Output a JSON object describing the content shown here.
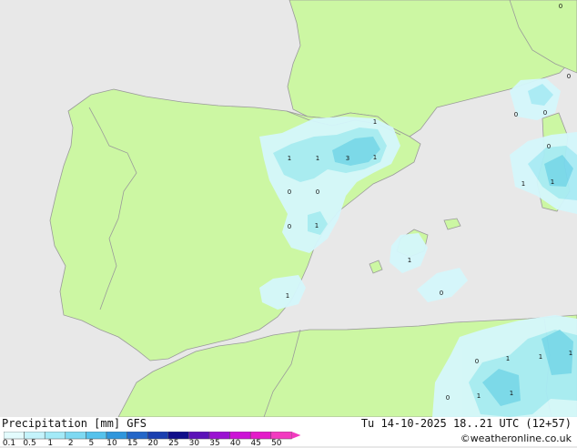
{
  "map": {
    "colors": {
      "sea": "#e8e8e8",
      "land": "#ccf7a3",
      "border": "#9a9a9a",
      "precip_light": "#d5f7fc",
      "precip_mid": "#a8ecf5",
      "precip_heavy": "#78d8ec"
    },
    "point_labels": [
      "1",
      "1",
      "1",
      "3",
      "1",
      "1",
      "0",
      "0",
      "0",
      "1",
      "1",
      "1",
      "0",
      "0",
      "0",
      "0",
      "1",
      "0",
      "0",
      "0",
      "1",
      "1",
      "1",
      "0",
      "1",
      "1"
    ]
  },
  "footer": {
    "title": "Precipitation [mm]  GFS",
    "timestamp": "Tu 14-10-2025 18..21 UTC (12+57)",
    "credit": "©weatheronline.co.uk"
  },
  "legend": {
    "ticks": [
      "0.1",
      "0.5",
      "1",
      "2",
      "5",
      "10",
      "15",
      "20",
      "25",
      "30",
      "35",
      "40",
      "45",
      "50"
    ],
    "colors": [
      "#e3fbfd",
      "#c4f3fb",
      "#a3eaf7",
      "#7ed9f2",
      "#55c2ec",
      "#2f96dc",
      "#2366c8",
      "#1a3fb0",
      "#100e8a",
      "#5b12b8",
      "#9a12d2",
      "#cc13d6",
      "#e41bc9",
      "#f23ac0"
    ]
  }
}
